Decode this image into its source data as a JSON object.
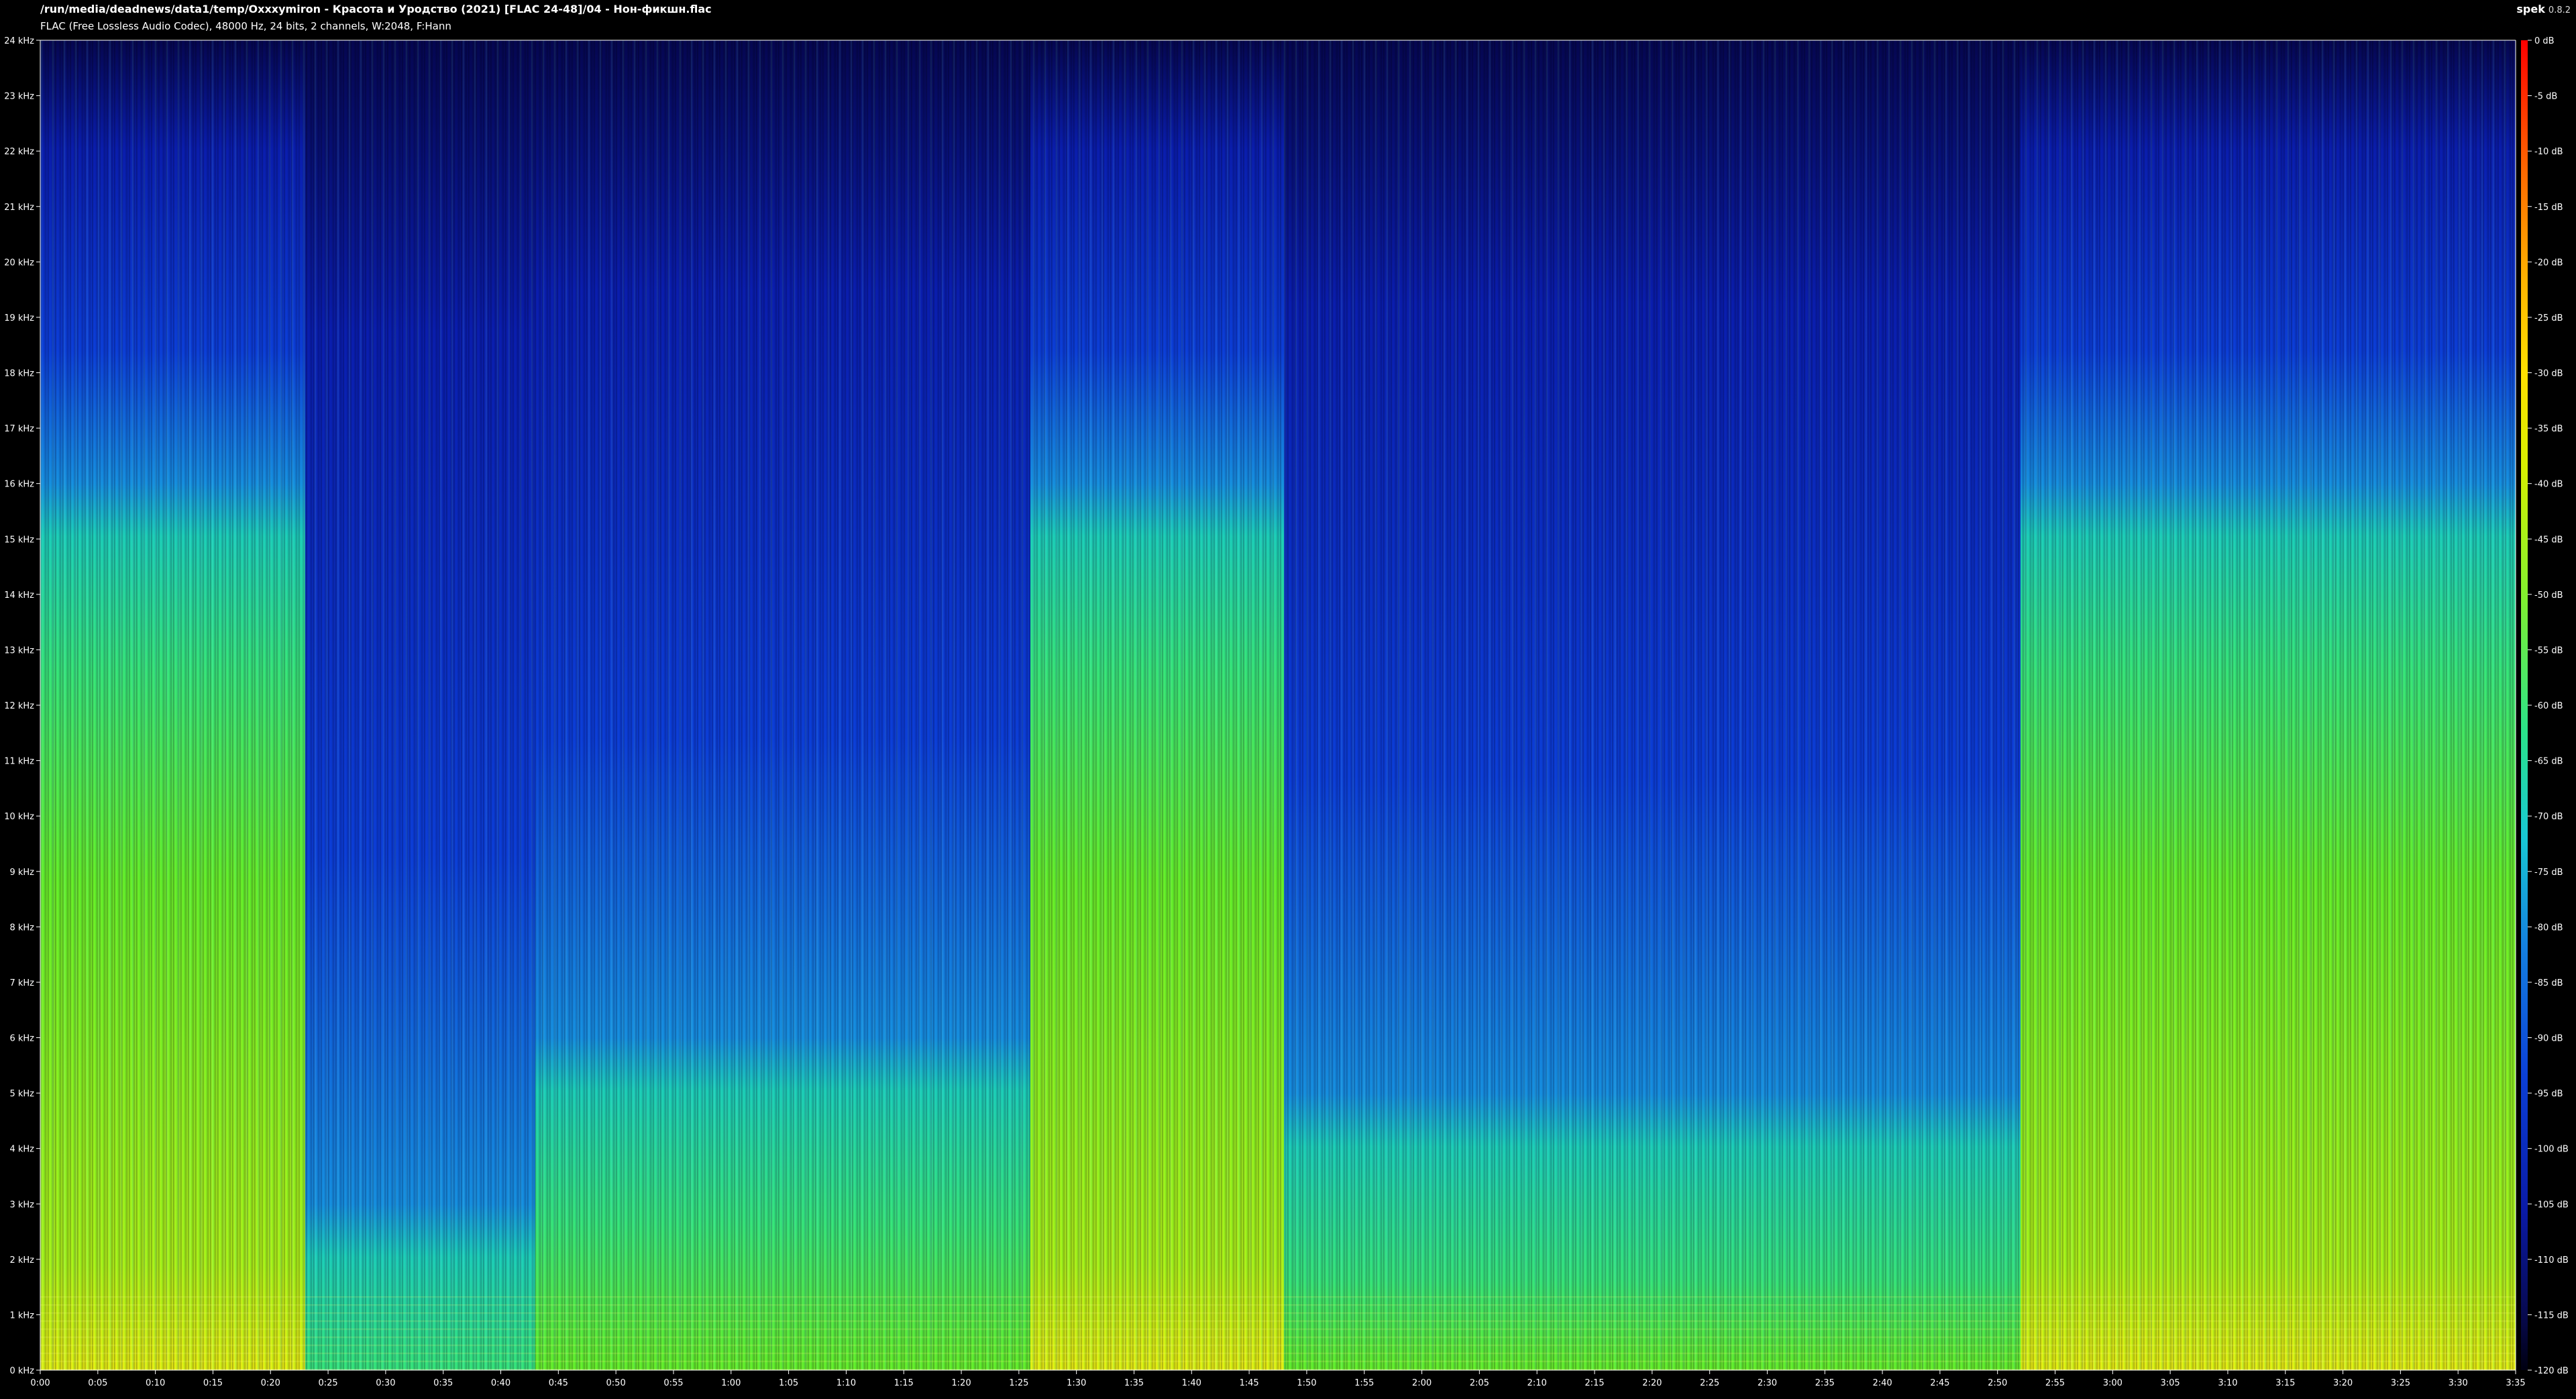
{
  "window": {
    "title": "/run/media/deadnews/data1/temp/Oxxxymiron - Красота и Уродство (2021) [FLAC 24-48]/04 - Нон-фикшн.flac",
    "subtitle": "FLAC (Free Lossless Audio Codec), 48000 Hz, 24 bits, 2 channels, W:2048, F:Hann",
    "app_name": "spek",
    "app_version": "0.8.2"
  },
  "colors": {
    "background": "#000000",
    "low_level": "#07094d",
    "mid_level": "#18c8d4",
    "high_level": "#6af02c",
    "peak_level": "#ff0000"
  },
  "chart_data": {
    "type": "heatmap",
    "title": "",
    "xlabel": "",
    "ylabel": "",
    "x_range_seconds": [
      0,
      215
    ],
    "y_range_khz": [
      0,
      24
    ],
    "color_range_db": [
      -120,
      0
    ],
    "x_ticks": [
      "0:00",
      "0:05",
      "0:10",
      "0:15",
      "0:20",
      "0:25",
      "0:30",
      "0:35",
      "0:40",
      "0:45",
      "0:50",
      "0:55",
      "1:00",
      "1:05",
      "1:10",
      "1:15",
      "1:20",
      "1:25",
      "1:30",
      "1:35",
      "1:40",
      "1:45",
      "1:50",
      "1:55",
      "2:00",
      "2:05",
      "2:10",
      "2:15",
      "2:20",
      "2:25",
      "2:30",
      "2:35",
      "2:40",
      "2:45",
      "2:50",
      "2:55",
      "3:00",
      "3:05",
      "3:10",
      "3:15",
      "3:20",
      "3:25",
      "3:30",
      "3:35"
    ],
    "y_ticks": [
      "0 kHz",
      "1 kHz",
      "2 kHz",
      "3 kHz",
      "4 kHz",
      "5 kHz",
      "6 kHz",
      "7 kHz",
      "8 kHz",
      "9 kHz",
      "10 kHz",
      "11 kHz",
      "12 kHz",
      "13 kHz",
      "14 kHz",
      "15 kHz",
      "16 kHz",
      "17 kHz",
      "18 kHz",
      "19 kHz",
      "20 kHz",
      "21 kHz",
      "22 kHz",
      "23 kHz",
      "24 kHz"
    ],
    "colorbar_ticks": [
      "0 dB",
      "-5 dB",
      "-10 dB",
      "-15 dB",
      "-20 dB",
      "-25 dB",
      "-30 dB",
      "-35 dB",
      "-40 dB",
      "-45 dB",
      "-50 dB",
      "-55 dB",
      "-60 dB",
      "-65 dB",
      "-70 dB",
      "-75 dB",
      "-80 dB",
      "-85 dB",
      "-90 dB",
      "-95 dB",
      "-100 dB",
      "-105 dB",
      "-110 dB",
      "-115 dB",
      "-120 dB"
    ],
    "segments": [
      {
        "start_s": 0,
        "end_s": 23,
        "energy_top_khz": 16
      },
      {
        "start_s": 23,
        "end_s": 43,
        "energy_top_khz": 3
      },
      {
        "start_s": 43,
        "end_s": 86,
        "energy_top_khz": 6
      },
      {
        "start_s": 86,
        "end_s": 108,
        "energy_top_khz": 16
      },
      {
        "start_s": 108,
        "end_s": 172,
        "energy_top_khz": 5
      },
      {
        "start_s": 172,
        "end_s": 215,
        "energy_top_khz": 16
      }
    ]
  }
}
